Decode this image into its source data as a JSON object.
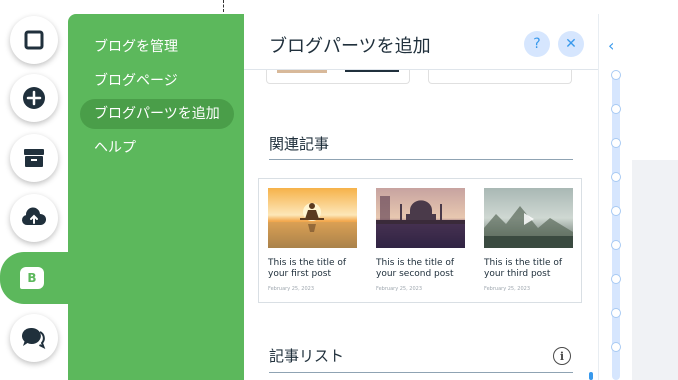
{
  "side_menu": {
    "items": [
      {
        "label": "ブログを管理"
      },
      {
        "label": "ブログページ"
      },
      {
        "label": "ブログパーツを追加"
      },
      {
        "label": "ヘルプ"
      }
    ]
  },
  "rail": {
    "icons": [
      "page-icon",
      "add-icon",
      "store-icon",
      "upload-icon",
      "blog-icon",
      "chat-icon"
    ],
    "blog_badge": "B"
  },
  "panel": {
    "title": "ブログパーツを追加",
    "help_glyph": "?",
    "close_glyph": "✕"
  },
  "sections": {
    "related": {
      "title": "関連記事"
    },
    "list": {
      "title": "記事リスト",
      "info_glyph": "i"
    }
  },
  "posts": [
    {
      "title": "This is the title of your first post",
      "date": "February 25, 2023"
    },
    {
      "title": "This is the title of your second post",
      "date": "February 25, 2023"
    },
    {
      "title": "This is the title of your third post",
      "date": "February 25, 2023"
    }
  ],
  "scroller": {
    "collapse_glyph": "‹",
    "stops": 9
  },
  "colors": {
    "green": "#5cb85c",
    "green_active": "#4a9e49",
    "accent_blue": "#3899ec",
    "light_blue": "#d6e6fe",
    "text_dark": "#20303c"
  }
}
